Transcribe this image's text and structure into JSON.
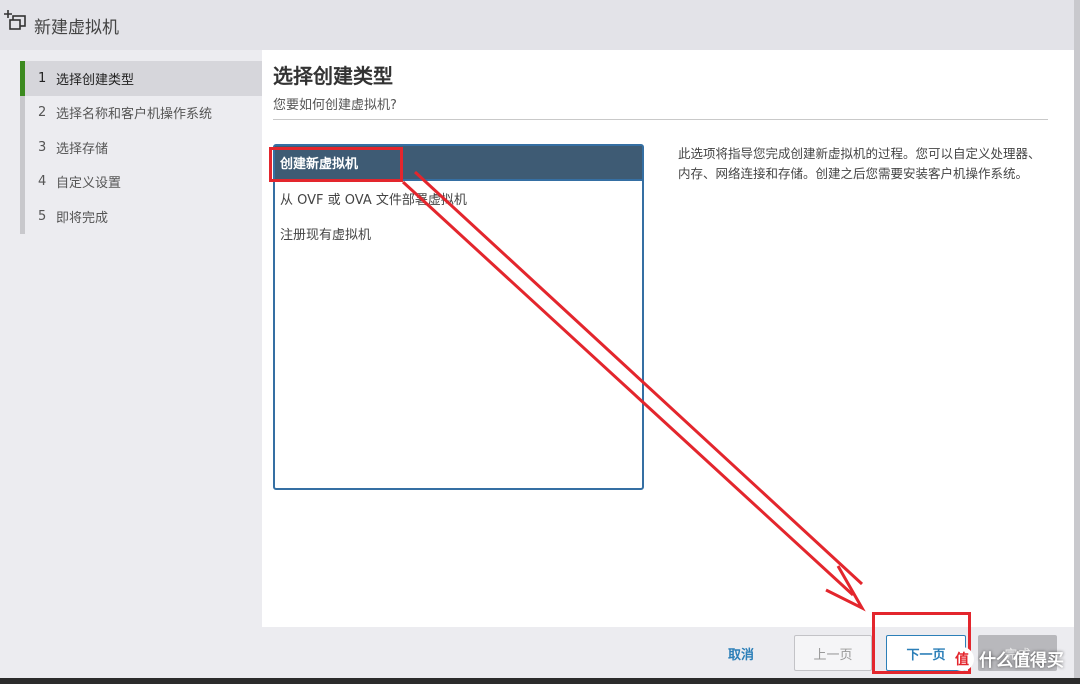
{
  "window": {
    "title": "新建虚拟机",
    "icon": "new-vm-icon"
  },
  "wizard": {
    "steps": [
      {
        "num": "1",
        "label": "选择创建类型",
        "active": true
      },
      {
        "num": "2",
        "label": "选择名称和客户机操作系统",
        "active": false
      },
      {
        "num": "3",
        "label": "选择存储",
        "active": false
      },
      {
        "num": "4",
        "label": "自定义设置",
        "active": false
      },
      {
        "num": "5",
        "label": "即将完成",
        "active": false
      }
    ]
  },
  "main": {
    "title": "选择创建类型",
    "subtitle": "您要如何创建虚拟机?",
    "creation_types": [
      {
        "label": "创建新虚拟机",
        "selected": true
      },
      {
        "label": "从 OVF 或 OVA 文件部署虚拟机",
        "selected": false
      },
      {
        "label": "注册现有虚拟机",
        "selected": false
      }
    ],
    "description": "此选项将指导您完成创建新虚拟机的过程。您可以自定义处理器、内存、网络连接和存储。创建之后您需要安装客户机操作系统。"
  },
  "footer": {
    "cancel_label": "取消",
    "prev_label": "上一页",
    "next_label": "下一页",
    "finish_label": "完成"
  },
  "watermark": {
    "logo_text": "值",
    "text": "什么值得买"
  },
  "colors": {
    "accent": "#2c7fb8",
    "selected_row": "#3e5b74",
    "active_step_marker": "#3c8a1f",
    "annotation": "#e3262d"
  }
}
